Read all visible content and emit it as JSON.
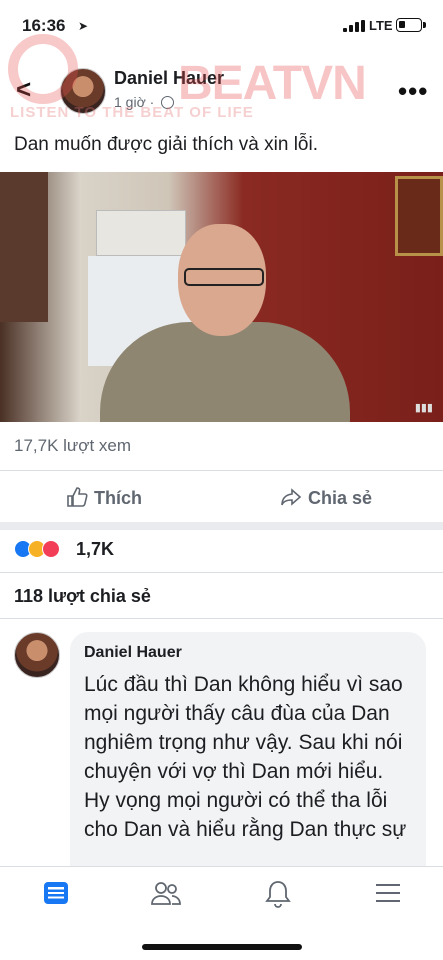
{
  "status": {
    "time": "16:36",
    "network": "LTE"
  },
  "post": {
    "author": "Daniel Hauer",
    "time_ago": "1 giờ",
    "caption": "Dan muốn được giải thích và xin lỗi.",
    "views": "17,7K lượt xem",
    "like_label": "Thích",
    "share_label": "Chia sẻ",
    "reaction_count": "1,7K",
    "share_count": "118 lượt chia sẻ"
  },
  "watermark": {
    "brand": "BEATVN",
    "tagline": "LISTEN TO THE BEAT OF LIFE"
  },
  "comment": {
    "author": "Daniel Hauer",
    "text": "Lúc đầu thì Dan không hiểu vì sao mọi người thấy câu đùa của Dan nghiêm trọng như vậy. Sau khi nói chuyện với vợ thì Dan mới hiểu. Hy vọng mọi người có thể tha lỗi cho Dan và hiểu rằng Dan thực sự"
  },
  "tabs": [
    {
      "icon": "news-feed-icon",
      "active": true
    },
    {
      "icon": "friends-icon",
      "active": false
    },
    {
      "icon": "bell-icon",
      "active": false
    },
    {
      "icon": "menu-icon",
      "active": false
    }
  ],
  "colors": {
    "accent": "#1877f2",
    "muted": "#606770",
    "like": "#1877f2",
    "angry": "#f7b125",
    "love": "#f33e58"
  }
}
